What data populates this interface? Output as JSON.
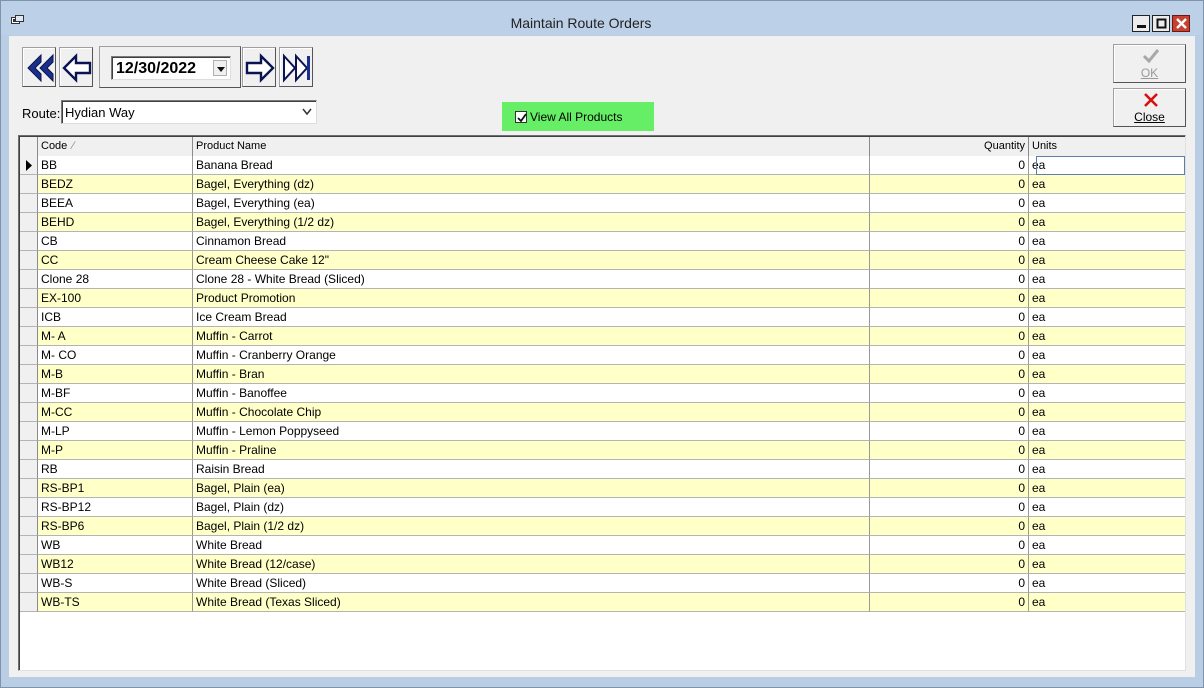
{
  "window": {
    "title": "Maintain Route Orders",
    "icon": "app-window-icon",
    "controls": [
      "minimize-icon",
      "maximize-icon",
      "close-icon"
    ]
  },
  "toolbar": {
    "first_icon": "double-left-arrow-icon",
    "prev_icon": "left-arrow-icon",
    "next_icon": "right-arrow-icon",
    "last_icon": "double-right-arrow-icon",
    "date_value": "12/30/2022"
  },
  "buttons": {
    "ok_label": "OK",
    "ok_icon": "checkmark-icon",
    "close_label": "Close",
    "close_icon": "red-x-icon"
  },
  "route": {
    "label": "Route:",
    "value": "Hydian Way"
  },
  "view_all": {
    "label": "View All Products",
    "checked": true,
    "color": "#66ee66"
  },
  "colors": {
    "row_alt": "#ffffc8",
    "row_normal": "#ffffff"
  },
  "grid": {
    "columns": [
      "Code",
      "Product Name",
      "Quantity",
      "Units"
    ],
    "sort_indicator": "∕",
    "rows": [
      {
        "code": "BB",
        "name": "Banana Bread",
        "qty": "0",
        "units": "ea"
      },
      {
        "code": "BEDZ",
        "name": "Bagel, Everything (dz)",
        "qty": "0",
        "units": "ea"
      },
      {
        "code": "BEEA",
        "name": "Bagel, Everything (ea)",
        "qty": "0",
        "units": "ea"
      },
      {
        "code": "BEHD",
        "name": "Bagel, Everything (1/2 dz)",
        "qty": "0",
        "units": "ea"
      },
      {
        "code": "CB",
        "name": "Cinnamon Bread",
        "qty": "0",
        "units": "ea"
      },
      {
        "code": "CC",
        "name": "Cream Cheese Cake 12\"",
        "qty": "0",
        "units": "ea"
      },
      {
        "code": "Clone 28",
        "name": "Clone 28 - White Bread (Sliced)",
        "qty": "0",
        "units": "ea"
      },
      {
        "code": "EX-100",
        "name": "Product Promotion",
        "qty": "0",
        "units": "ea"
      },
      {
        "code": "ICB",
        "name": "Ice Cream Bread",
        "qty": "0",
        "units": "ea"
      },
      {
        "code": "M- A",
        "name": "Muffin - Carrot",
        "qty": "0",
        "units": "ea"
      },
      {
        "code": "M- CO",
        "name": "Muffin - Cranberry Orange",
        "qty": "0",
        "units": "ea"
      },
      {
        "code": "M-B",
        "name": "Muffin - Bran",
        "qty": "0",
        "units": "ea"
      },
      {
        "code": "M-BF",
        "name": "Muffin - Banoffee",
        "qty": "0",
        "units": "ea"
      },
      {
        "code": "M-CC",
        "name": "Muffin - Chocolate Chip",
        "qty": "0",
        "units": "ea"
      },
      {
        "code": "M-LP",
        "name": "Muffin - Lemon Poppyseed",
        "qty": "0",
        "units": "ea"
      },
      {
        "code": "M-P",
        "name": "Muffin - Praline",
        "qty": "0",
        "units": "ea"
      },
      {
        "code": "RB",
        "name": "Raisin Bread",
        "qty": "0",
        "units": "ea"
      },
      {
        "code": "RS-BP1",
        "name": "Bagel, Plain (ea)",
        "qty": "0",
        "units": "ea"
      },
      {
        "code": "RS-BP12",
        "name": "Bagel, Plain (dz)",
        "qty": "0",
        "units": "ea"
      },
      {
        "code": "RS-BP6",
        "name": "Bagel, Plain (1/2 dz)",
        "qty": "0",
        "units": "ea"
      },
      {
        "code": "WB",
        "name": "White Bread",
        "qty": "0",
        "units": "ea"
      },
      {
        "code": "WB12",
        "name": "White Bread (12/case)",
        "qty": "0",
        "units": "ea"
      },
      {
        "code": "WB-S",
        "name": "White Bread (Sliced)",
        "qty": "0",
        "units": "ea"
      },
      {
        "code": "WB-TS",
        "name": "White Bread (Texas Sliced)",
        "qty": "0",
        "units": "ea"
      }
    ]
  }
}
